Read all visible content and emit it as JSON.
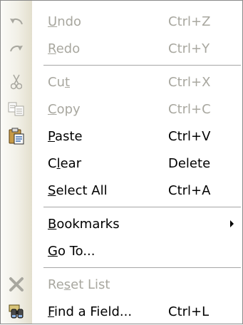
{
  "menu": {
    "items": [
      {
        "type": "item",
        "label": "Undo",
        "mnemonic": 0,
        "shortcut": "Ctrl+Z",
        "disabled": true,
        "icon": "undo-icon"
      },
      {
        "type": "item",
        "label": "Redo",
        "mnemonic": 0,
        "shortcut": "Ctrl+Y",
        "disabled": true,
        "icon": "redo-icon"
      },
      {
        "type": "separator"
      },
      {
        "type": "item",
        "label": "Cut",
        "mnemonic": 2,
        "shortcut": "Ctrl+X",
        "disabled": true,
        "icon": "scissors-icon"
      },
      {
        "type": "item",
        "label": "Copy",
        "mnemonic": 0,
        "shortcut": "Ctrl+C",
        "disabled": true,
        "icon": "copy-icon"
      },
      {
        "type": "item",
        "label": "Paste",
        "mnemonic": 0,
        "shortcut": "Ctrl+V",
        "disabled": false,
        "icon": "clipboard-icon"
      },
      {
        "type": "item",
        "label": "Clear",
        "mnemonic": 1,
        "shortcut": "Delete",
        "disabled": false,
        "icon": ""
      },
      {
        "type": "item",
        "label": "Select All",
        "mnemonic": 0,
        "shortcut": "Ctrl+A",
        "disabled": false,
        "icon": ""
      },
      {
        "type": "separator"
      },
      {
        "type": "item",
        "label": "Bookmarks",
        "mnemonic": 0,
        "shortcut": "",
        "disabled": false,
        "icon": "",
        "submenu": true
      },
      {
        "type": "item",
        "label": "Go To...",
        "mnemonic": 0,
        "shortcut": "",
        "disabled": false,
        "icon": ""
      },
      {
        "type": "separator"
      },
      {
        "type": "item",
        "label": "Reset List",
        "mnemonic": 2,
        "shortcut": "",
        "disabled": true,
        "icon": "x-icon"
      },
      {
        "type": "item",
        "label": "Find a Field...",
        "mnemonic": 0,
        "shortcut": "Ctrl+L",
        "disabled": false,
        "icon": "binoculars-icon"
      }
    ]
  }
}
